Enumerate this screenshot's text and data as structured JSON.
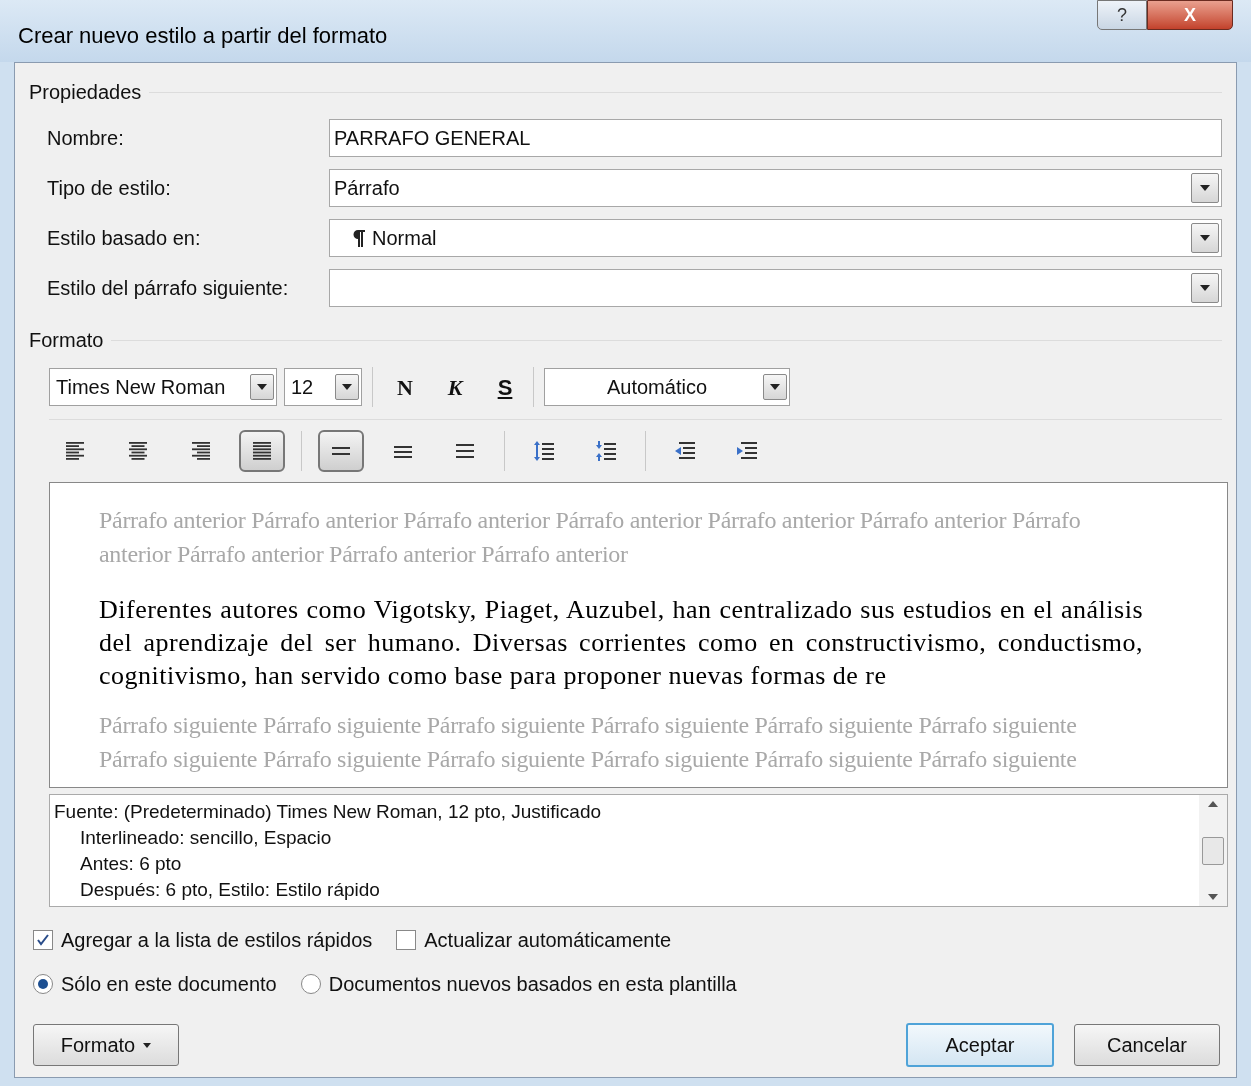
{
  "window": {
    "title": "Crear nuevo estilo a partir del formato",
    "help_button": "?",
    "close_button": "X"
  },
  "properties": {
    "heading": "Propiedades",
    "fields": [
      {
        "label": "Nombre:",
        "kind": "text",
        "value": "PARRAFO GENERAL"
      },
      {
        "label": "Tipo de estilo:",
        "kind": "dropdown",
        "value": "Párrafo"
      },
      {
        "label": "Estilo basado en:",
        "kind": "dropdown",
        "value": "Normal",
        "paragraph_mark": true
      },
      {
        "label": "Estilo del párrafo siguiente:",
        "kind": "dropdown"
      }
    ]
  },
  "format": {
    "heading": "Formato",
    "font": "Times New Roman",
    "size": "12",
    "bold": "N",
    "italic": "K",
    "underline": "S",
    "color_label": "Automático",
    "paragraph_buttons": [
      {
        "kind": "align-left",
        "selected": false
      },
      {
        "kind": "align-center",
        "selected": false
      },
      {
        "kind": "align-right",
        "selected": false
      },
      {
        "kind": "justify",
        "selected": true
      },
      {
        "kind": "spacing-single",
        "selected": true
      },
      {
        "kind": "spacing-onehalf",
        "selected": false
      },
      {
        "kind": "spacing-double",
        "selected": false
      },
      {
        "kind": "space-increase",
        "selected": false
      },
      {
        "kind": "space-decrease",
        "selected": false
      },
      {
        "kind": "indent-decrease",
        "selected": false
      },
      {
        "kind": "indent-increase",
        "selected": false
      }
    ]
  },
  "preview": {
    "previous": "Párrafo anterior Párrafo anterior Párrafo anterior Párrafo anterior Párrafo anterior Párrafo anterior Párrafo anterior Párrafo anterior Párrafo anterior Párrafo anterior",
    "sample": "Diferentes autores como Vigotsky, Piaget, Auzubel, han centralizado sus estudios en el análisis del aprendizaje del ser humano. Diversas corrientes como en constructivismo, conductismo, cognitivismo, han servido como base para proponer nuevas formas de re",
    "next": "Párrafo siguiente Párrafo siguiente Párrafo siguiente Párrafo siguiente Párrafo siguiente Párrafo siguiente Párrafo siguiente Párrafo siguiente Párrafo siguiente Párrafo siguiente Párrafo siguiente Párrafo siguiente"
  },
  "description": [
    "Fuente: (Predeterminado) Times New Roman, 12 pto, Justificado",
    "Interlineado:  sencillo, Espacio",
    "Antes:  6 pto",
    "Después:  6 pto, Estilo: Estilo rápido"
  ],
  "options": {
    "checkboxes": [
      {
        "label": "Agregar a la lista de estilos rápidos",
        "checked": true
      },
      {
        "label": "Actualizar automáticamente",
        "checked": false
      }
    ],
    "radios": [
      {
        "label": "Sólo en este documento",
        "selected": true
      },
      {
        "label": "Documentos nuevos basados en esta plantilla",
        "selected": false
      }
    ]
  },
  "buttons": {
    "format": "Formato",
    "ok": "Aceptar",
    "cancel": "Cancelar"
  }
}
